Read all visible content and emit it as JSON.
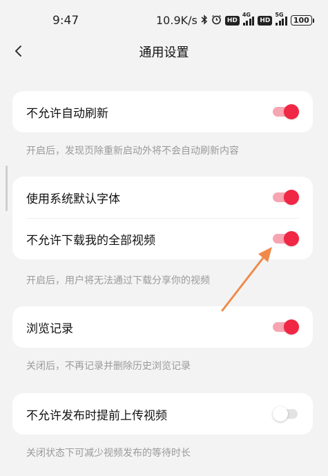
{
  "status_bar": {
    "time": "9:47",
    "speed": "10.9K/s",
    "icons": [
      "bluetooth-icon",
      "alarm-icon",
      "hd-icon",
      "signal-4g-icon",
      "hd-icon",
      "signal-5g-icon"
    ],
    "hd_label": "HD",
    "net_4g": "4G",
    "net_5g": "5G",
    "battery": "100"
  },
  "nav": {
    "back_icon": "chevron-left-icon",
    "title": "通用设置"
  },
  "sections": [
    {
      "rows": [
        {
          "label": "不允许自动刷新",
          "enabled": true
        }
      ],
      "description": "开启后，发现页除重新启动外将不会自动刷新内容"
    },
    {
      "rows": [
        {
          "label": "使用系统默认字体",
          "enabled": true
        },
        {
          "label": "不允许下载我的全部视频",
          "enabled": true
        }
      ],
      "description": "开启后，用户将无法通过下载分享你的视频"
    },
    {
      "rows": [
        {
          "label": "浏览记录",
          "enabled": true
        }
      ],
      "description": "关闭后，不再记录并删除历史浏览记录"
    },
    {
      "rows": [
        {
          "label": "不允许发布时提前上传视频",
          "enabled": false
        }
      ],
      "description": "关闭状态下可减少视频发布的等待时长"
    }
  ],
  "colors": {
    "accent": "#f02745",
    "accent_track": "#f7a5b2",
    "annotation_arrow": "#f08a4b",
    "background": "#f3f3f3"
  }
}
